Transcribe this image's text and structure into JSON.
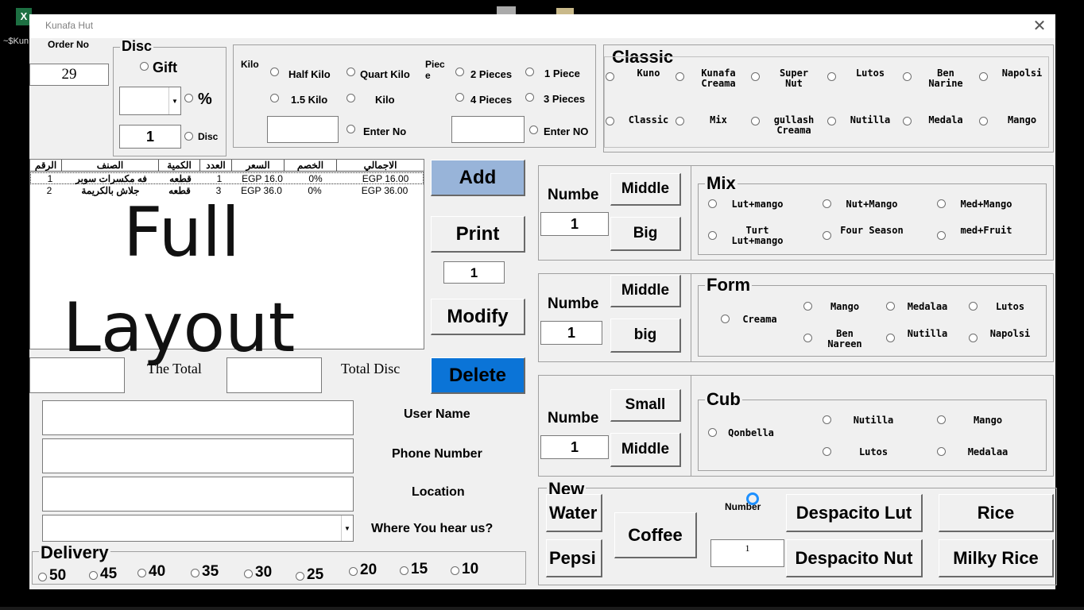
{
  "desktop": {
    "file_label": "~$Kun"
  },
  "window": {
    "title": "Kunafa Hut",
    "close": "✕"
  },
  "order": {
    "label": "Order No",
    "value": "29"
  },
  "disc": {
    "title": "Disc",
    "gift": "Gift",
    "percent": "%",
    "disc_label": "Disc",
    "qty": "1"
  },
  "kilo": {
    "label": "Kilo",
    "half": "Half Kilo",
    "quart": "Quart Kilo",
    "one_half": "1.5 Kilo",
    "kilo": "Kilo",
    "enter": "Enter No"
  },
  "piece": {
    "label": "Piec\ne",
    "p2": "2 Pieces",
    "p1": "1 Piece",
    "p4": "4 Pieces",
    "p3": "3 Pieces",
    "enter": "Enter NO"
  },
  "classic": {
    "title": "Classic",
    "row1": [
      "Kuno",
      "Kunafa\nCreama",
      "Super\nNut",
      "Lutos",
      "Ben\nNarine",
      "Napolsi"
    ],
    "row2": [
      "Classic",
      "Mix",
      "gullash\nCreama",
      "Nutilla",
      "Medala",
      "Mango"
    ]
  },
  "list": {
    "headers": [
      "الرقم",
      "الصنف",
      "الكمية",
      "العدد",
      "السعر",
      "الخصم",
      "الاجمالي"
    ],
    "rows": [
      [
        "1",
        "فه مكسرات سوبر",
        "قطعه",
        "1",
        "EGP 16.0",
        "0%",
        "EGP 16.00"
      ],
      [
        "2",
        "جلاش بالكريمة",
        "قطعه",
        "3",
        "EGP 36.0",
        "0%",
        "EGP 36.00"
      ]
    ]
  },
  "overlay": {
    "line1": "Full",
    "line2": "Layout"
  },
  "actions": {
    "add": "Add",
    "print": "Print",
    "print_qty": "1",
    "modify": "Modify",
    "delete": "Delete"
  },
  "totals": {
    "total": "The Total",
    "total_disc": "Total Disc"
  },
  "customer": {
    "user": "User Name",
    "phone": "Phone Number",
    "location": "Location",
    "hear": "Where You hear us?"
  },
  "delivery": {
    "title": "Delivery",
    "options": [
      "50",
      "45",
      "40",
      "35",
      "30",
      "25",
      "20",
      "15",
      "10"
    ]
  },
  "size1": {
    "numbe": "Numbe",
    "qty": "1",
    "b1": "Middle",
    "b2": "Big"
  },
  "mix": {
    "title": "Mix",
    "items": [
      "Lut+mango",
      "Nut+Mango",
      "Med+Mango",
      "Turt\nLut+mango",
      "Four Season",
      "med+Fruit"
    ]
  },
  "size2": {
    "numbe": "Numbe",
    "qty": "1",
    "b1": "Middle",
    "b2": "big"
  },
  "form": {
    "title": "Form",
    "creama": "Creama",
    "items": [
      "Mango",
      "Medalaa",
      "Lutos",
      "Ben\nNareen",
      "Nutilla",
      "Napolsi"
    ]
  },
  "size3": {
    "numbe": "Numbe",
    "qty": "1",
    "b1": "Small",
    "b2": "Middle"
  },
  "cub": {
    "title": "Cub",
    "qonbella": "Qonbella",
    "items": [
      "Nutilla",
      "Mango",
      "Lutos",
      "Medalaa"
    ]
  },
  "new": {
    "title": "New",
    "water": "Water",
    "pepsi": "Pepsi",
    "coffee": "Coffee",
    "number": "Number",
    "qty": "1",
    "desp_lut": "Despacito Lut",
    "desp_nut": "Despacito Nut",
    "rice": "Rice",
    "milky": "Milky Rice"
  }
}
